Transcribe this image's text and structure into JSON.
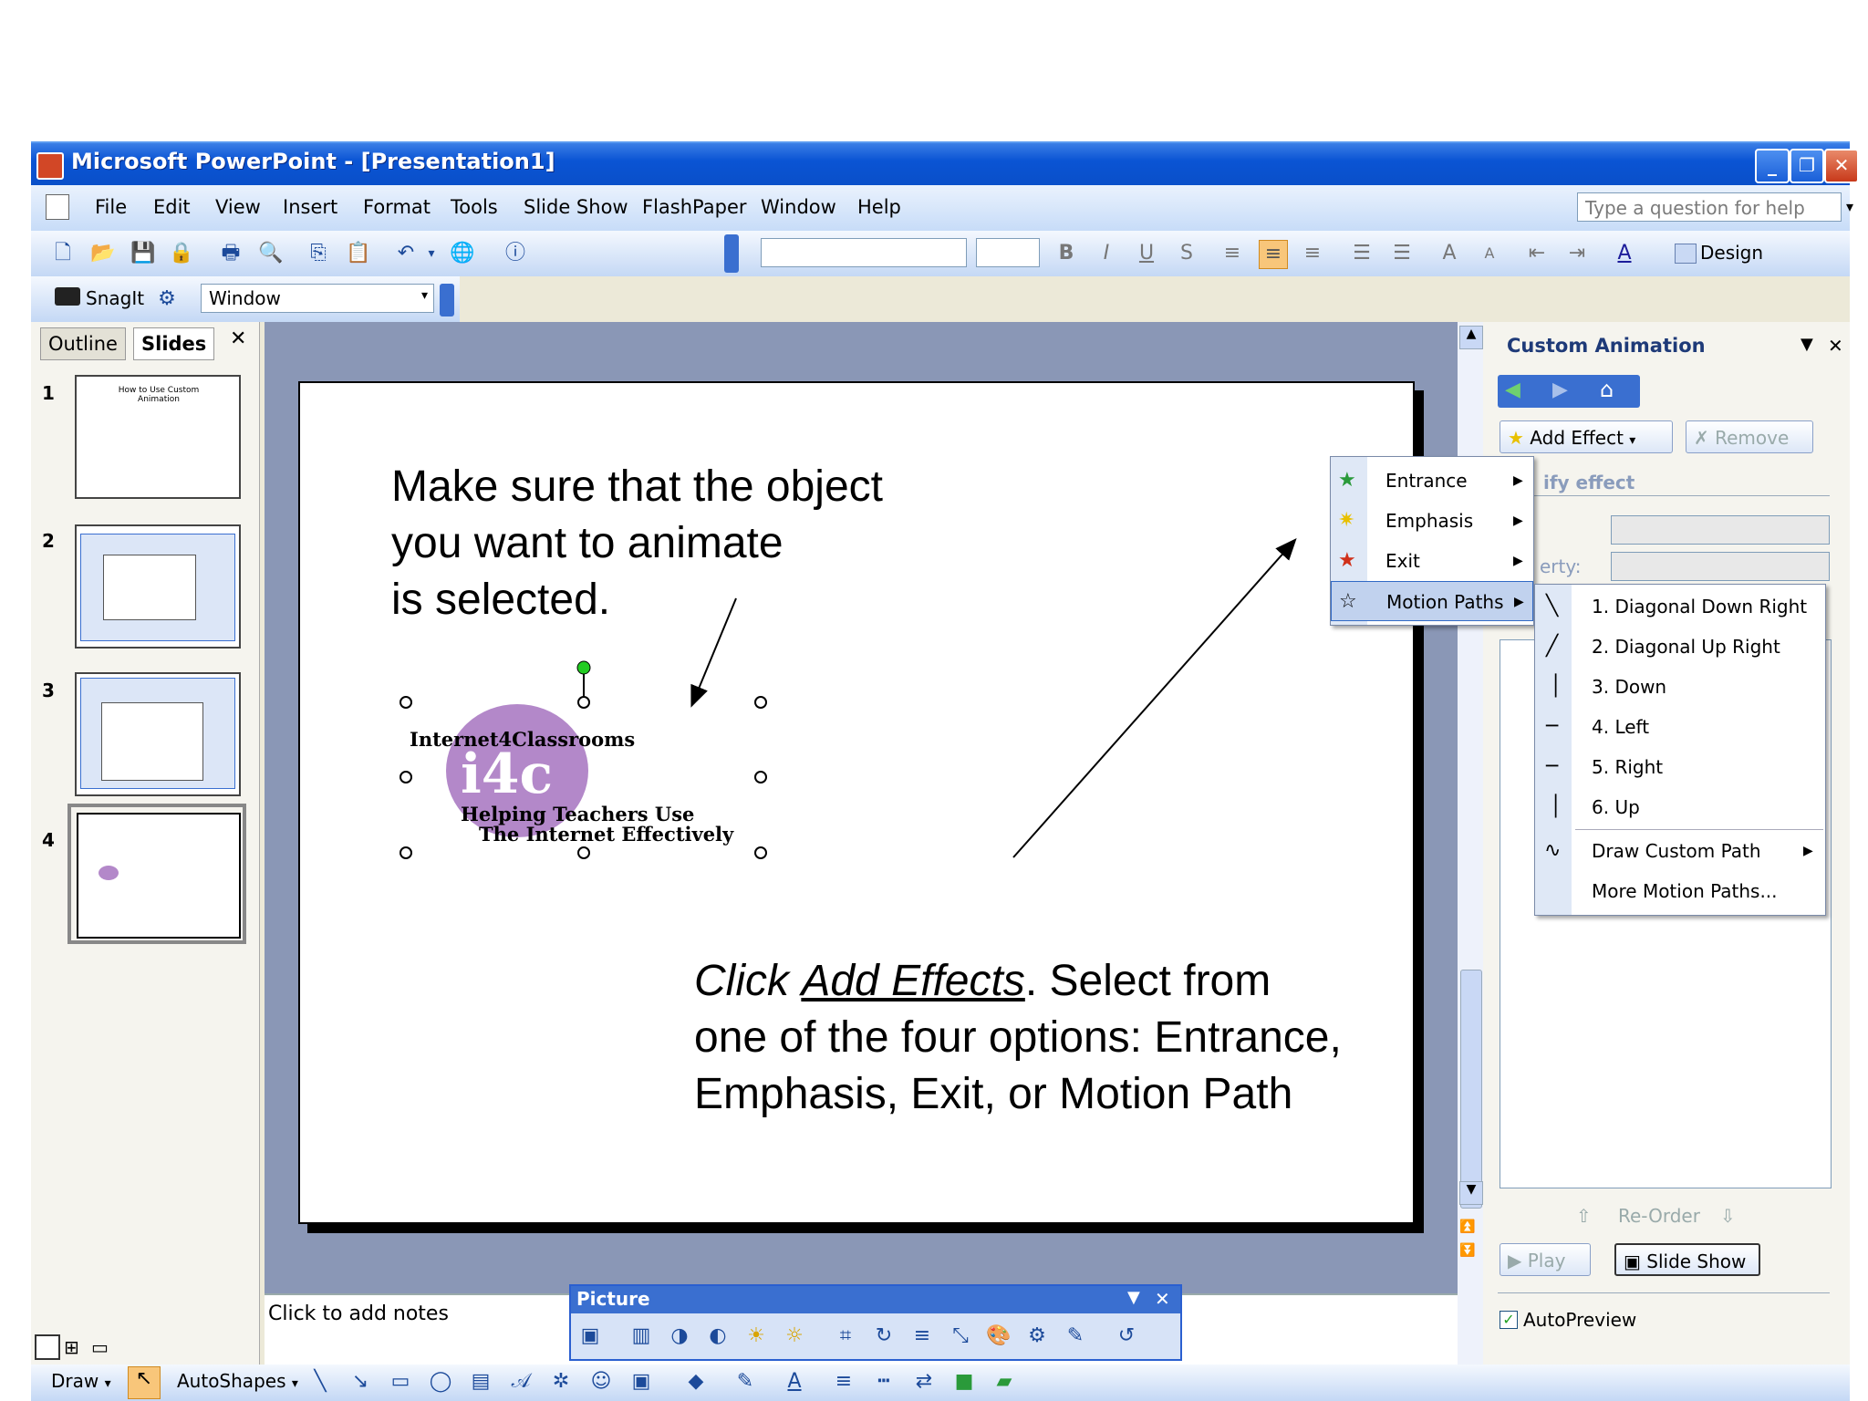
{
  "window": {
    "title": "Microsoft PowerPoint - [Presentation1]"
  },
  "menubar": {
    "items": [
      "File",
      "Edit",
      "View",
      "Insert",
      "Format",
      "Tools",
      "Slide Show",
      "FlashPaper",
      "Window",
      "Help"
    ],
    "help_placeholder": "Type a question for help"
  },
  "toolbar": {
    "design_label": "Design"
  },
  "snagit": {
    "label": "SnagIt",
    "window_value": "Window"
  },
  "left_panel": {
    "tab_outline": "Outline",
    "tab_slides": "Slides",
    "slide_numbers": [
      "1",
      "2",
      "3",
      "4"
    ],
    "slide1_title": "How to Use Custom Animation"
  },
  "slide": {
    "instruction_line1": "Make sure that the object",
    "instruction_line2": "you want to animate",
    "instruction_line3": "is selected.",
    "logo_top": "Internet4Classrooms",
    "logo_mark": "i4c",
    "logo_line1": "Helping Teachers Use",
    "logo_line2": "The Internet Effectively",
    "click_word": "Click",
    "add_effects_word": "Add Effects",
    "select_rest": ".  Select from",
    "line2": "one of the four options: Entrance,",
    "line3": "Emphasis, Exit, or Motion Path"
  },
  "notes": {
    "placeholder": "Click to add notes"
  },
  "task_pane": {
    "title": "Custom Animation",
    "add_effect": "Add Effect",
    "remove": "Remove",
    "modify_effect": "ify effect",
    "property_label": "erty:",
    "reorder": "Re-Order",
    "play": "Play",
    "slide_show": "Slide Show",
    "autopreview": "AutoPreview"
  },
  "effect_menu": {
    "items": [
      "Entrance",
      "Emphasis",
      "Exit",
      "Motion Paths"
    ]
  },
  "motion_paths_menu": {
    "items": [
      "1. Diagonal Down Right",
      "2. Diagonal Up Right",
      "3. Down",
      "4. Left",
      "5. Right",
      "6. Up",
      "Draw Custom Path",
      "More Motion Paths..."
    ]
  },
  "picture_toolbar": {
    "title": "Picture"
  },
  "draw_toolbar": {
    "draw": "Draw",
    "autoshapes": "AutoShapes"
  },
  "colors": {
    "xp_blue": "#0a54d4",
    "menu_highlight": "#c1d2ee",
    "logo_purple": "#b388c9"
  }
}
